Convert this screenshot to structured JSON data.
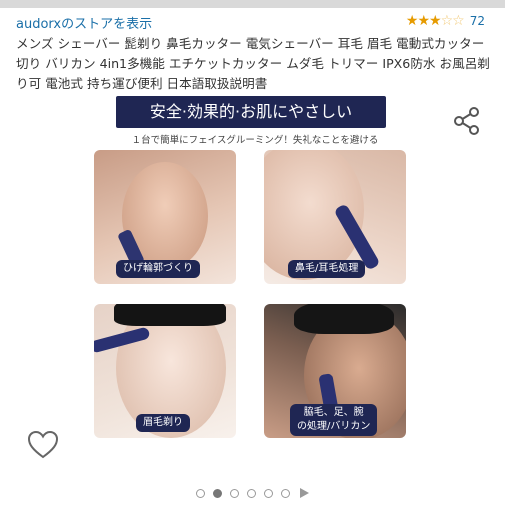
{
  "store": {
    "link_text": "audorxのストアを表示"
  },
  "rating": {
    "stars_filled": 3,
    "stars_total": 5,
    "count": "72",
    "star_color": "#e69b00"
  },
  "product": {
    "title": "メンズ シェーバー 髭剃り 鼻毛カッター 電気シェーバー 耳毛 眉毛 電動式カッター 切り バリカン 4in1多機能 エチケットカッター ムダ毛 トリマー IPX6防水 お風呂剃り可 電池式 持ち運び便利 日本語取扱説明書"
  },
  "image": {
    "headline": "安全·効果的·お肌にやさしい",
    "subline": "１台で簡単にフェイスグルーミング！失礼なことを避ける",
    "panels": [
      {
        "caption": "ひげ輪郭づくり"
      },
      {
        "caption": "鼻毛/耳毛処理"
      },
      {
        "caption": "眉毛剃り"
      },
      {
        "caption_line1": "脇毛、足、腕",
        "caption_line2": "の処理/バリカン"
      }
    ],
    "caption_bg": "#1f2653"
  },
  "icons": {
    "share": "share-icon",
    "favorite": "heart-icon",
    "next": "play-arrow-icon"
  },
  "carousel": {
    "total_dots": 6,
    "active_index": 1
  }
}
